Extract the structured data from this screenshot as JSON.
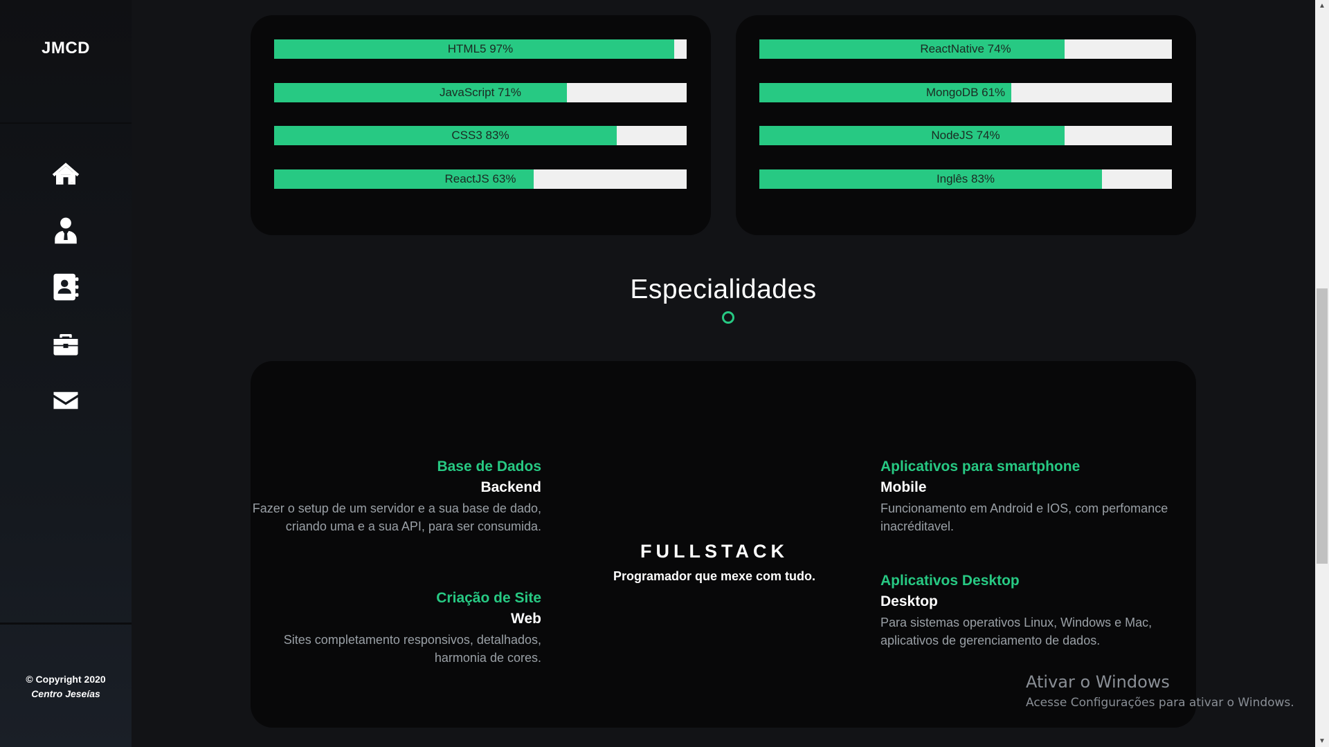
{
  "sidebar": {
    "brand": "JMCD",
    "nav": [
      {
        "icon": "home-icon"
      },
      {
        "icon": "user-icon"
      },
      {
        "icon": "contact-book-icon"
      },
      {
        "icon": "briefcase-icon"
      },
      {
        "icon": "mail-icon"
      }
    ],
    "copyright_line1": "© Copyright 2020",
    "copyright_line2": "Centro Jeseías"
  },
  "skills": {
    "left": [
      {
        "label": "HTML5 97%",
        "value": 97
      },
      {
        "label": "JavaScript 71%",
        "value": 71
      },
      {
        "label": "CSS3 83%",
        "value": 83
      },
      {
        "label": "ReactJS 63%",
        "value": 63
      }
    ],
    "right": [
      {
        "label": "ReactNative 74%",
        "value": 74
      },
      {
        "label": "MongoDB 61%",
        "value": 61
      },
      {
        "label": "NodeJS 74%",
        "value": 74
      },
      {
        "label": "Inglês 83%",
        "value": 83
      }
    ]
  },
  "specialties": {
    "title": "Especialidades",
    "center_title": "FULLSTACK",
    "center_subtitle": "Programador que mexe com tudo.",
    "items": [
      {
        "title": "Base de Dados",
        "subtitle": "Backend",
        "text": "Fazer o setup de um servidor e a sua base de dado, criando uma e a sua API, para ser consumida."
      },
      {
        "title": "Criação de Site",
        "subtitle": "Web",
        "text": "Sites completamento responsivos, detalhados, harmonia de cores."
      },
      {
        "title": "Aplicativos para smartphone",
        "subtitle": "Mobile",
        "text": "Funcionamento em Android e IOS, com perfomance inacréditavel."
      },
      {
        "title": "Aplicativos Desktop",
        "subtitle": "Desktop",
        "text": "Para sistemas operativos Linux, Windows e Mac, aplicativos de gerenciamento de dados."
      }
    ]
  },
  "watermark": {
    "line1": "Ativar o Windows",
    "line2": "Acesse Configurações para ativar o Windows."
  },
  "colors": {
    "accent": "#27c983",
    "bar_background": "#f0f0f0",
    "card_background": "#080809",
    "page_background": "#121316"
  }
}
